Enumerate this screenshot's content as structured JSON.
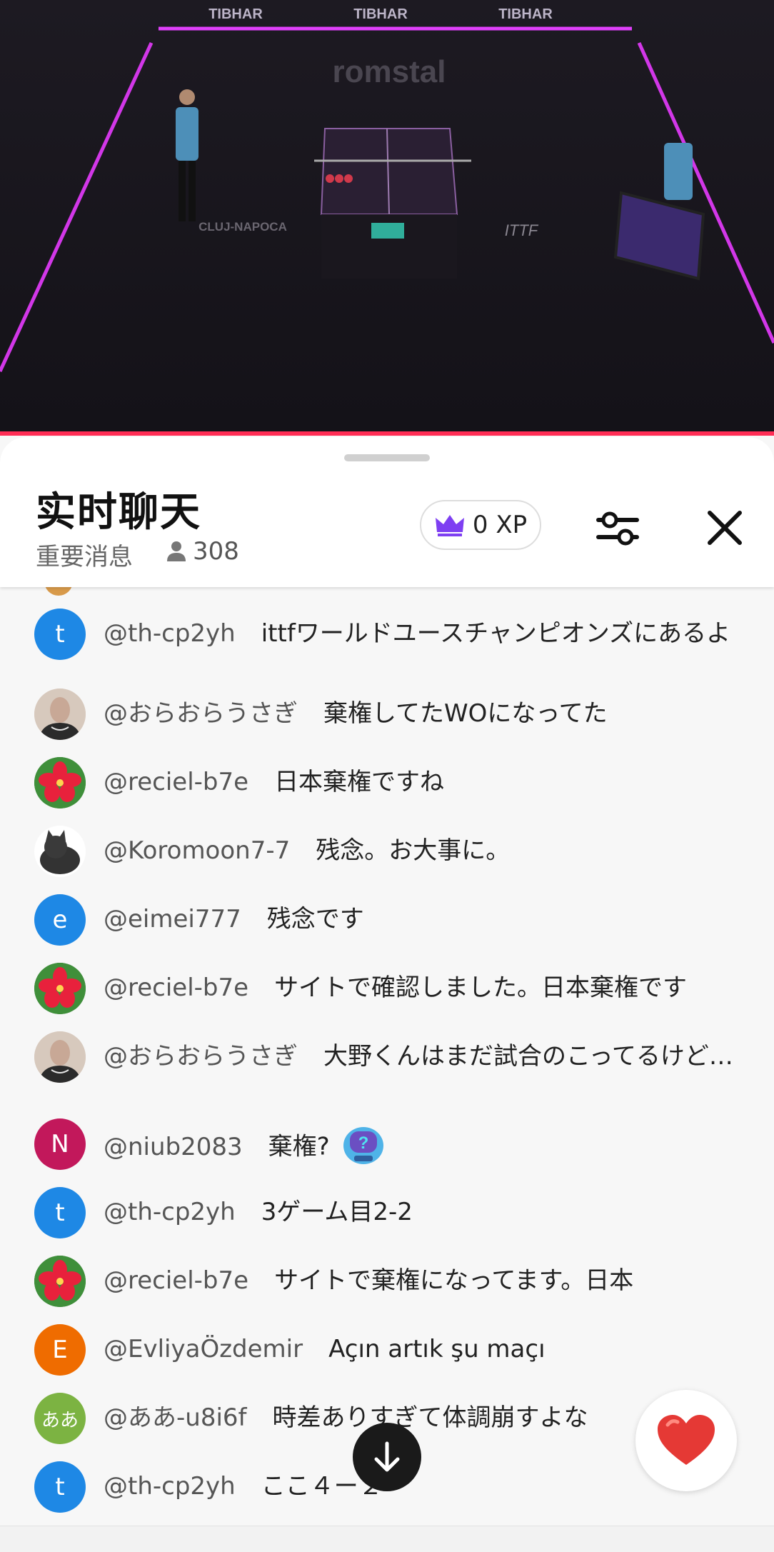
{
  "video": {
    "sponsors": [
      "TIBHAR",
      "TIBHAR",
      "TIBHAR"
    ],
    "floor_brand": "romstal",
    "floor_text": "CLUJ-NAPOCA",
    "floor_logo": "ITTF"
  },
  "chat": {
    "title": "实时聊天",
    "subtitle": "重要消息",
    "viewer_count": "308",
    "xp_label": "0 XP",
    "icons": {
      "xp": "crown-icon",
      "filter": "sliders-icon",
      "close": "close-icon",
      "viewers": "person-icon"
    },
    "messages": [
      {
        "user": "@th-cp2yh",
        "text": "ittfワールドユースチャンピオンズにあるよ",
        "avatar": {
          "type": "letter",
          "letter": "t",
          "color": "#1e88e5"
        }
      },
      {
        "user": "@おらおらうさぎ",
        "text": "棄権してたWOになってた",
        "avatar": {
          "type": "photo",
          "color": "#e8dcd2"
        }
      },
      {
        "user": "@reciel-b7e",
        "text": "日本棄権ですね",
        "avatar": {
          "type": "flower",
          "color": "#2e7d32"
        }
      },
      {
        "user": "@Koromoon7-7",
        "text": "残念。お大事に。",
        "avatar": {
          "type": "cat",
          "color": "#ffffff"
        }
      },
      {
        "user": "@eimei777",
        "text": "残念です",
        "avatar": {
          "type": "letter",
          "letter": "e",
          "color": "#1e88e5"
        }
      },
      {
        "user": "@reciel-b7e",
        "text": "サイトで確認しました。日本棄権です",
        "avatar": {
          "type": "flower",
          "color": "#2e7d32"
        }
      },
      {
        "user": "@おらおらうさぎ",
        "text": "大野くんはまだ試合のこってるけど…",
        "avatar": {
          "type": "photo",
          "color": "#e8dcd2"
        }
      },
      {
        "user": "@niub2083",
        "text": "棄権?",
        "avatar": {
          "type": "letter",
          "letter": "N",
          "color": "#c2185b"
        },
        "emote": "question-robot-emote"
      },
      {
        "user": "@th-cp2yh",
        "text": "3ゲーム目2-2",
        "avatar": {
          "type": "letter",
          "letter": "t",
          "color": "#1e88e5"
        }
      },
      {
        "user": "@reciel-b7e",
        "text": "サイトで棄権になってます。日本",
        "avatar": {
          "type": "flower",
          "color": "#2e7d32"
        }
      },
      {
        "user": "@EvliyaÖzdemir",
        "text": "Açın artık şu maçı",
        "avatar": {
          "type": "letter",
          "letter": "E",
          "color": "#ef6c00"
        }
      },
      {
        "user": "@ああ-u8i6f",
        "text": "時差ありすぎて体調崩すよな",
        "avatar": {
          "type": "letter",
          "letter": "ああ",
          "color": "#7cb342"
        }
      },
      {
        "user": "@th-cp2yh",
        "text": "ここ４ー２",
        "avatar": {
          "type": "letter",
          "letter": "t",
          "color": "#1e88e5"
        }
      }
    ]
  },
  "controls": {
    "scroll_down": "arrow-down-icon",
    "reaction": "heart-icon"
  }
}
